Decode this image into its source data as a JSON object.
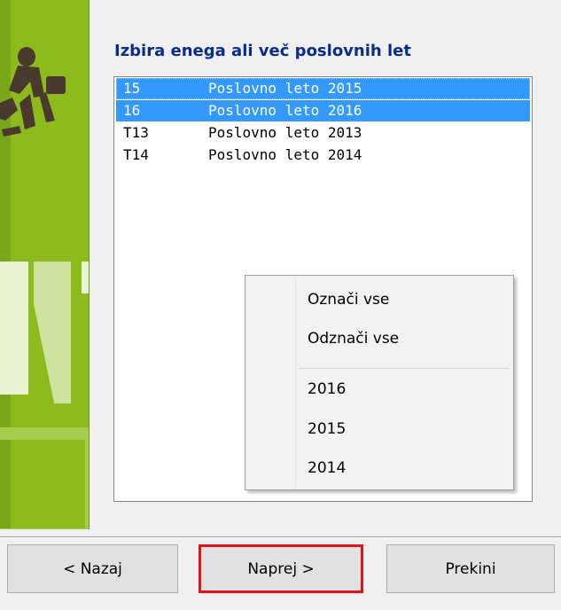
{
  "dialog": {
    "group_title": "Izbira enega ali več poslovnih let"
  },
  "list": {
    "items": [
      {
        "code": "15",
        "name": "Poslovno leto 2015",
        "selected": true
      },
      {
        "code": "16",
        "name": "Poslovno leto 2016",
        "selected": true
      },
      {
        "code": "T13",
        "name": "Poslovno leto 2013",
        "selected": false
      },
      {
        "code": "T14",
        "name": "Poslovno leto 2014",
        "selected": false
      }
    ]
  },
  "context_menu": {
    "items": [
      "Označi vse",
      "Odznači vse",
      "2016",
      "2015",
      "2014"
    ]
  },
  "buttons": {
    "back": "< Nazaj",
    "next": "Naprej >",
    "cancel": "Prekini"
  },
  "colors": {
    "banner": "#8dbb1e",
    "selection": "#3399ff",
    "title": "#0a2c8c",
    "highlight_border": "#e0141a"
  }
}
